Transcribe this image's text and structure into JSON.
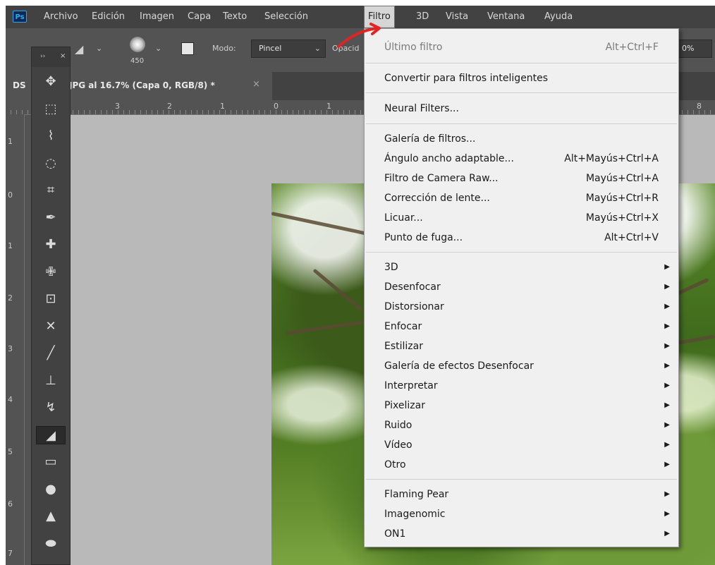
{
  "app": {
    "logo": "Ps"
  },
  "menubar": {
    "items": [
      {
        "label": "Archivo"
      },
      {
        "label": "Edición"
      },
      {
        "label": "Imagen"
      },
      {
        "label": "Capa"
      },
      {
        "label": "Texto"
      },
      {
        "label": "Selección"
      },
      {
        "label": "Filtro"
      },
      {
        "label": "3D"
      },
      {
        "label": "Vista"
      },
      {
        "label": "Ventana"
      },
      {
        "label": "Ayuda"
      }
    ],
    "active": "Filtro"
  },
  "options": {
    "brush_size": "450",
    "mode_label": "Modo:",
    "mode_value": "Pincel",
    "opacity_label": "Opacid",
    "right_value": "0%"
  },
  "tab": {
    "prefix": "DS",
    "title": "JPG al 16.7% (Capa 0, RGB/8) *",
    "close": "×"
  },
  "ruler": {
    "top": [
      "3",
      "2",
      "1",
      "0",
      "1",
      "8"
    ],
    "left": [
      "1",
      "0",
      "1",
      "2",
      "3",
      "4",
      "5",
      "6",
      "7"
    ]
  },
  "toolbox": {
    "expand": "››",
    "close": "×",
    "tools": [
      {
        "name": "move-tool-icon",
        "glyph": "✥"
      },
      {
        "name": "marquee-tool-icon",
        "glyph": "⬚"
      },
      {
        "name": "lasso-tool-icon",
        "glyph": "⌇"
      },
      {
        "name": "quick-selection-tool-icon",
        "glyph": "◌"
      },
      {
        "name": "crop-tool-icon",
        "glyph": "⌗"
      },
      {
        "name": "eyedropper-tool-icon",
        "glyph": "✒"
      },
      {
        "name": "spot-healing-tool-icon",
        "glyph": "✚"
      },
      {
        "name": "healing-brush-tool-icon",
        "glyph": "✙"
      },
      {
        "name": "patch-tool-icon",
        "glyph": "⊡"
      },
      {
        "name": "content-aware-move-tool-icon",
        "glyph": "✕"
      },
      {
        "name": "brush-tool-icon",
        "glyph": "╱"
      },
      {
        "name": "clone-stamp-tool-icon",
        "glyph": "⊥"
      },
      {
        "name": "history-brush-tool-icon",
        "glyph": "↯"
      },
      {
        "name": "eraser-tool-icon",
        "glyph": "◢"
      },
      {
        "name": "gradient-tool-icon",
        "glyph": "▭"
      },
      {
        "name": "blur-tool-icon",
        "glyph": "●"
      },
      {
        "name": "sharpen-tool-icon",
        "glyph": "▲"
      },
      {
        "name": "dodge-tool-icon",
        "glyph": "⬬"
      }
    ]
  },
  "filter_menu": {
    "last_filter": {
      "label": "Último filtro",
      "shortcut": "Alt+Ctrl+F"
    },
    "smart": {
      "label": "Convertir para filtros inteligentes"
    },
    "neural": {
      "label": "Neural Filters..."
    },
    "group1": [
      {
        "label": "Galería de filtros...",
        "shortcut": ""
      },
      {
        "label": "Ángulo ancho adaptable...",
        "shortcut": "Alt+Mayús+Ctrl+A"
      },
      {
        "label": "Filtro de Camera Raw...",
        "shortcut": "Mayús+Ctrl+A"
      },
      {
        "label": "Corrección de lente...",
        "shortcut": "Mayús+Ctrl+R"
      },
      {
        "label": "Licuar...",
        "shortcut": "Mayús+Ctrl+X"
      },
      {
        "label": "Punto de fuga...",
        "shortcut": "Alt+Ctrl+V"
      }
    ],
    "group2": [
      {
        "label": "3D"
      },
      {
        "label": "Desenfocar"
      },
      {
        "label": "Distorsionar"
      },
      {
        "label": "Enfocar"
      },
      {
        "label": "Estilizar"
      },
      {
        "label": "Galería de efectos Desenfocar"
      },
      {
        "label": "Interpretar"
      },
      {
        "label": "Pixelizar"
      },
      {
        "label": "Ruido"
      },
      {
        "label": "Vídeo"
      },
      {
        "label": "Otro"
      }
    ],
    "group3": [
      {
        "label": "Flaming Pear"
      },
      {
        "label": "Imagenomic"
      },
      {
        "label": "ON1"
      }
    ],
    "submenu_arrow": "▶"
  },
  "colors": {
    "annotation": "#e02424",
    "menu_bg": "#f0f0f0",
    "app_bg": "#535353"
  }
}
